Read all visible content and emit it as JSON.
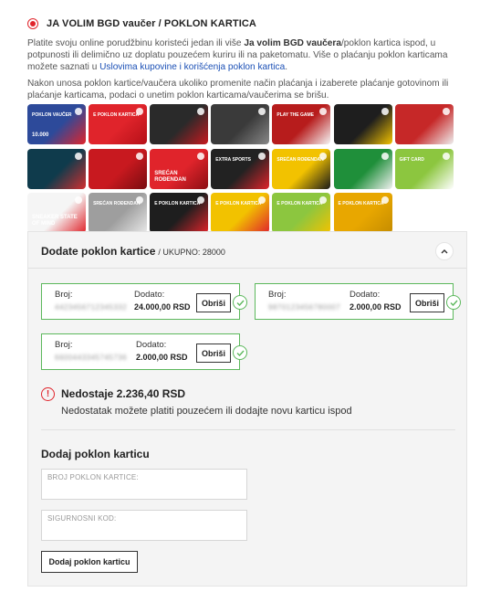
{
  "option": {
    "label": "JA VOLIM BGD vaučer / POKLON KARTICA",
    "selected": true
  },
  "intro": {
    "p1_a": "Platite svoju online porudžbinu koristeći jedan ili više ",
    "p1_b": "Ja volim BGD vaučera",
    "p1_c": "/poklon kartica ispod, u potpunosti ili delimično uz doplatu pouzećem kuriru ili na paketomatu. Više o plaćanju poklon karticama možete saznati u ",
    "p1_link": "Uslovima kupovine i korišćenja poklon kartica",
    "p1_d": ".",
    "p2": "Nakon unosa poklon kartice/vaučera ukoliko promenite način plaćanja i izaberete plaćanje gotovinom ili plaćanje karticama, podaci o unetim poklon karticama/vaučerima se brišu."
  },
  "cards": [
    {
      "text1": "POKLON VAUČER",
      "text2": "10.000",
      "color": "#2d4a9a",
      "color2": "#e0242b"
    },
    {
      "text1": "E POKLON KARTICA",
      "text2": "",
      "color": "#e0242b",
      "color2": "#b51018"
    },
    {
      "text1": "",
      "text2": "",
      "color": "#2a2a2a",
      "color2": "#c8191f"
    },
    {
      "text1": "",
      "text2": "",
      "color": "#3a3a3a",
      "color2": "#888888"
    },
    {
      "text1": "PLAY THE GAME",
      "text2": "",
      "color": "#b71c1c",
      "color2": "#f5f5f5"
    },
    {
      "text1": "",
      "text2": "",
      "color": "#1e1e1e",
      "color2": "#f2c200"
    },
    {
      "text1": "",
      "text2": "",
      "color": "#c62828",
      "color2": "#eeeeee"
    },
    {
      "text1": "",
      "text2": "",
      "color": "#0f3b4c",
      "color2": "#d32f2f"
    },
    {
      "text1": "",
      "text2": "",
      "color": "#c8191f",
      "color2": "#7a0c10"
    },
    {
      "text1": "",
      "text2": "SREĆAN ROĐENDAN",
      "color": "#e0242b",
      "color2": "#8c0f14"
    },
    {
      "text1": "EXTRA SPORTS",
      "text2": "",
      "color": "#222222",
      "color2": "#e0242b"
    },
    {
      "text1": "SREĆAN ROĐENDAN",
      "text2": "",
      "color": "#f2c200",
      "color2": "#1a1a1a"
    },
    {
      "text1": "",
      "text2": "",
      "color": "#1f8f3a",
      "color2": "#f0f0f0"
    },
    {
      "text1": "GIFT CARD",
      "text2": "",
      "color": "#8cc63f",
      "color2": "#ffffff"
    },
    {
      "text1": "",
      "text2": "SNEAKER STATE OF MIND",
      "color": "#f5f5f5",
      "color2": "#e0242b"
    },
    {
      "text1": "SREĆAN ROĐENDAN",
      "text2": "",
      "color": "#9e9e9e",
      "color2": "#e8e8e8"
    },
    {
      "text1": "E POKLON KARTICA",
      "text2": "",
      "color": "#1e1e1e",
      "color2": "#e0242b"
    },
    {
      "text1": "E POKLON KARTICA",
      "text2": "",
      "color": "#f2c200",
      "color2": "#e0242b"
    },
    {
      "text1": "E POKLON KARTICA",
      "text2": "",
      "color": "#8cc63f",
      "color2": "#f2c200"
    },
    {
      "text1": "E POKLON KARTICA",
      "text2": "",
      "color": "#e8a700",
      "color2": "#c58c00"
    }
  ],
  "panel": {
    "title": "Dodate poklon kartice",
    "total": "/ UKUPNO: 28000",
    "collapse_icon": "chevron-up-icon"
  },
  "added_cards": [
    {
      "broj_label": "Broj:",
      "number": "4423456712345332",
      "dodato_label": "Dodato:",
      "amount": "24.000,00 RSD",
      "delete_label": "Obriši"
    },
    {
      "broj_label": "Broj:",
      "number": "9870123456780007",
      "dodato_label": "Dodato:",
      "amount": "2.000,00 RSD",
      "delete_label": "Obriši"
    },
    {
      "broj_label": "Broj:",
      "number": "6600443345745736",
      "dodato_label": "Dodato:",
      "amount": "2.000,00 RSD",
      "delete_label": "Obriši"
    }
  ],
  "warning": {
    "title": "Nedostaje 2.236,40 RSD",
    "text": "Nedostatak možete platiti pouzećem ili dodajte novu karticu ispod"
  },
  "add_form": {
    "title": "Dodaj poklon karticu",
    "card_placeholder": "BROJ POKLON KARTICE:",
    "card_value": "",
    "code_placeholder": "SIGURNOSNI KOD:",
    "code_value": "",
    "button_label": "Dodaj poklon karticu"
  },
  "colors": {
    "accent": "#e0242b",
    "success": "#5cb85c",
    "link": "#1a4fb5"
  }
}
